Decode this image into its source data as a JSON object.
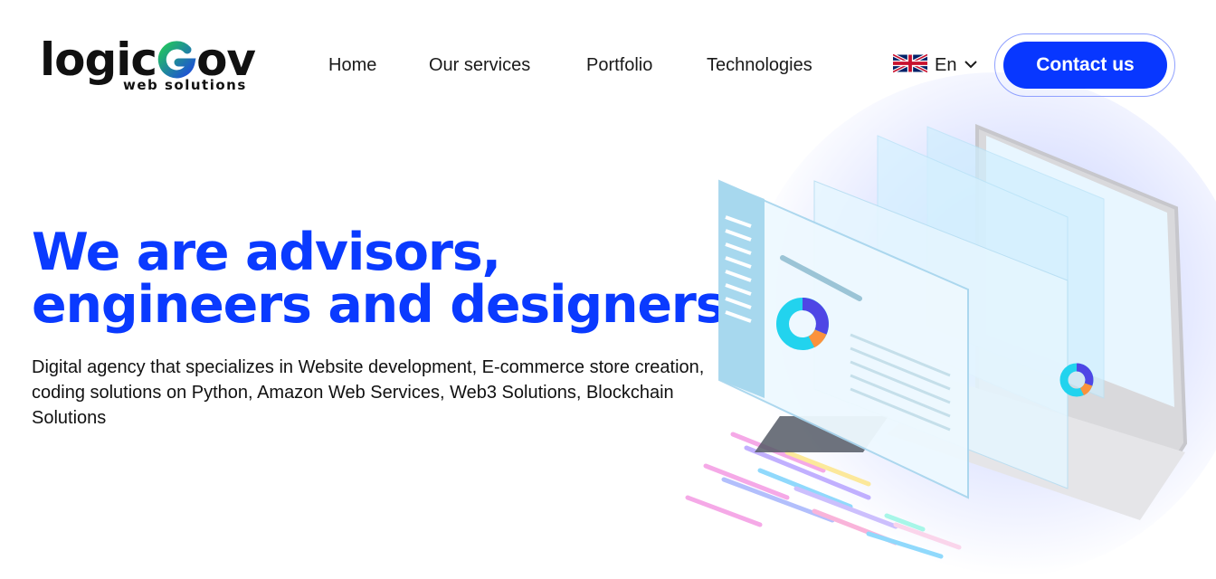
{
  "brand": {
    "logo_word_start": "logic",
    "logo_word_end": "ov",
    "logo_subtitle": "web solutions"
  },
  "nav": {
    "items": [
      {
        "label": "Home"
      },
      {
        "label": "Our services"
      },
      {
        "label": "Portfolio"
      },
      {
        "label": "Technologies"
      }
    ]
  },
  "language": {
    "label": "En",
    "flag_icon": "uk-flag-icon",
    "dropdown_icon": "chevron-down-icon"
  },
  "contact": {
    "label": "Contact us"
  },
  "hero": {
    "title_line1": "We are advisors,",
    "title_line2": "engineers and designers",
    "description": "Digital agency that specializes in Website development, E-commerce store creation, coding solutions on Python, Amazon Web Services, Web3 Solutions, Blockchain Solutions"
  },
  "colors": {
    "accent": "#0837ff",
    "heading": "#0a3aff",
    "logo_gradient_start": "#22c55e",
    "logo_gradient_end": "#1d4ed8"
  }
}
